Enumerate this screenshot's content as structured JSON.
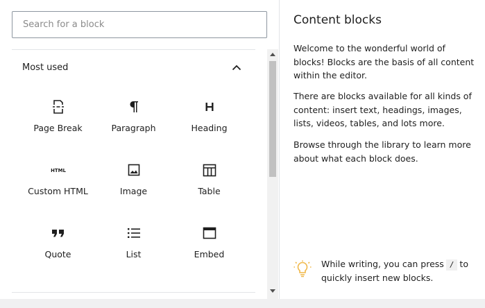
{
  "search": {
    "placeholder": "Search for a block",
    "value": ""
  },
  "panel": {
    "title": "Most used"
  },
  "blocks": [
    {
      "label": "Page Break",
      "icon": "page-break-icon"
    },
    {
      "label": "Paragraph",
      "icon": "paragraph-icon"
    },
    {
      "label": "Heading",
      "icon": "heading-icon"
    },
    {
      "label": "Custom HTML",
      "icon": "custom-html-icon"
    },
    {
      "label": "Image",
      "icon": "image-icon"
    },
    {
      "label": "Table",
      "icon": "table-icon"
    },
    {
      "label": "Quote",
      "icon": "quote-icon"
    },
    {
      "label": "List",
      "icon": "list-icon"
    },
    {
      "label": "Embed",
      "icon": "embed-icon"
    }
  ],
  "help": {
    "title": "Content blocks",
    "paragraphs": [
      "Welcome to the wonderful world of blocks! Blocks are the basis of all content within the editor.",
      "There are blocks available for all kinds of content: insert text, headings, images, lists, videos, tables, and lots more.",
      "Browse through the library to learn more about what each block does."
    ],
    "tip_before": "While writing, you can press",
    "tip_key": "/",
    "tip_after": "to quickly insert new blocks."
  },
  "colors": {
    "text": "#1e1e1e",
    "border": "#8d96a0",
    "tip_icon": "#f0b849"
  }
}
